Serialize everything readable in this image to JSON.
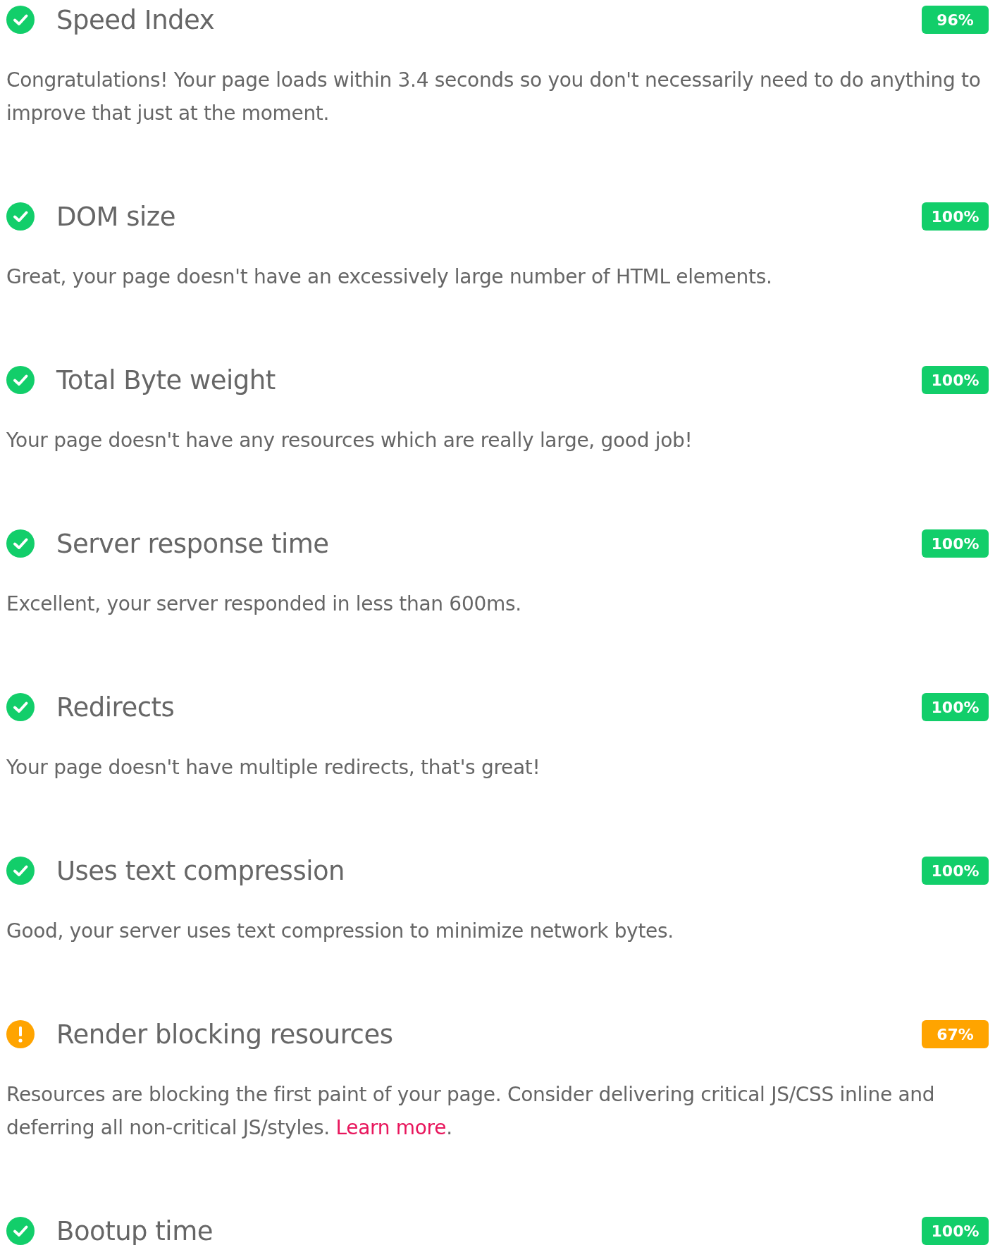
{
  "audits": [
    {
      "kind": "pass",
      "title": "Speed Index",
      "score": "96%",
      "description": "Congratulations! Your page loads within 3.4 seconds so you don't necessarily need to do anything to improve that just at the moment."
    },
    {
      "kind": "pass",
      "title": "DOM size",
      "score": "100%",
      "description": "Great, your page doesn't have an excessively large number of HTML elements."
    },
    {
      "kind": "pass",
      "title": "Total Byte weight",
      "score": "100%",
      "description": "Your page doesn't have any resources which are really large, good job!"
    },
    {
      "kind": "pass",
      "title": "Server response time",
      "score": "100%",
      "description": "Excellent, your server responded in less than 600ms."
    },
    {
      "kind": "pass",
      "title": "Redirects",
      "score": "100%",
      "description": "Your page doesn't have multiple redirects, that's great!"
    },
    {
      "kind": "pass",
      "title": "Uses text compression",
      "score": "100%",
      "description": "Good, your server uses text compression to minimize network bytes."
    },
    {
      "kind": "warn",
      "title": "Render blocking resources",
      "score": "67%",
      "description": "Resources are blocking the first paint of your page. Consider delivering critical JS/CSS inline and deferring all non-critical JS/styles.",
      "link": "Learn more",
      "link_suffix": "."
    },
    {
      "kind": "pass",
      "title": "Bootup time",
      "score": "100%"
    }
  ]
}
